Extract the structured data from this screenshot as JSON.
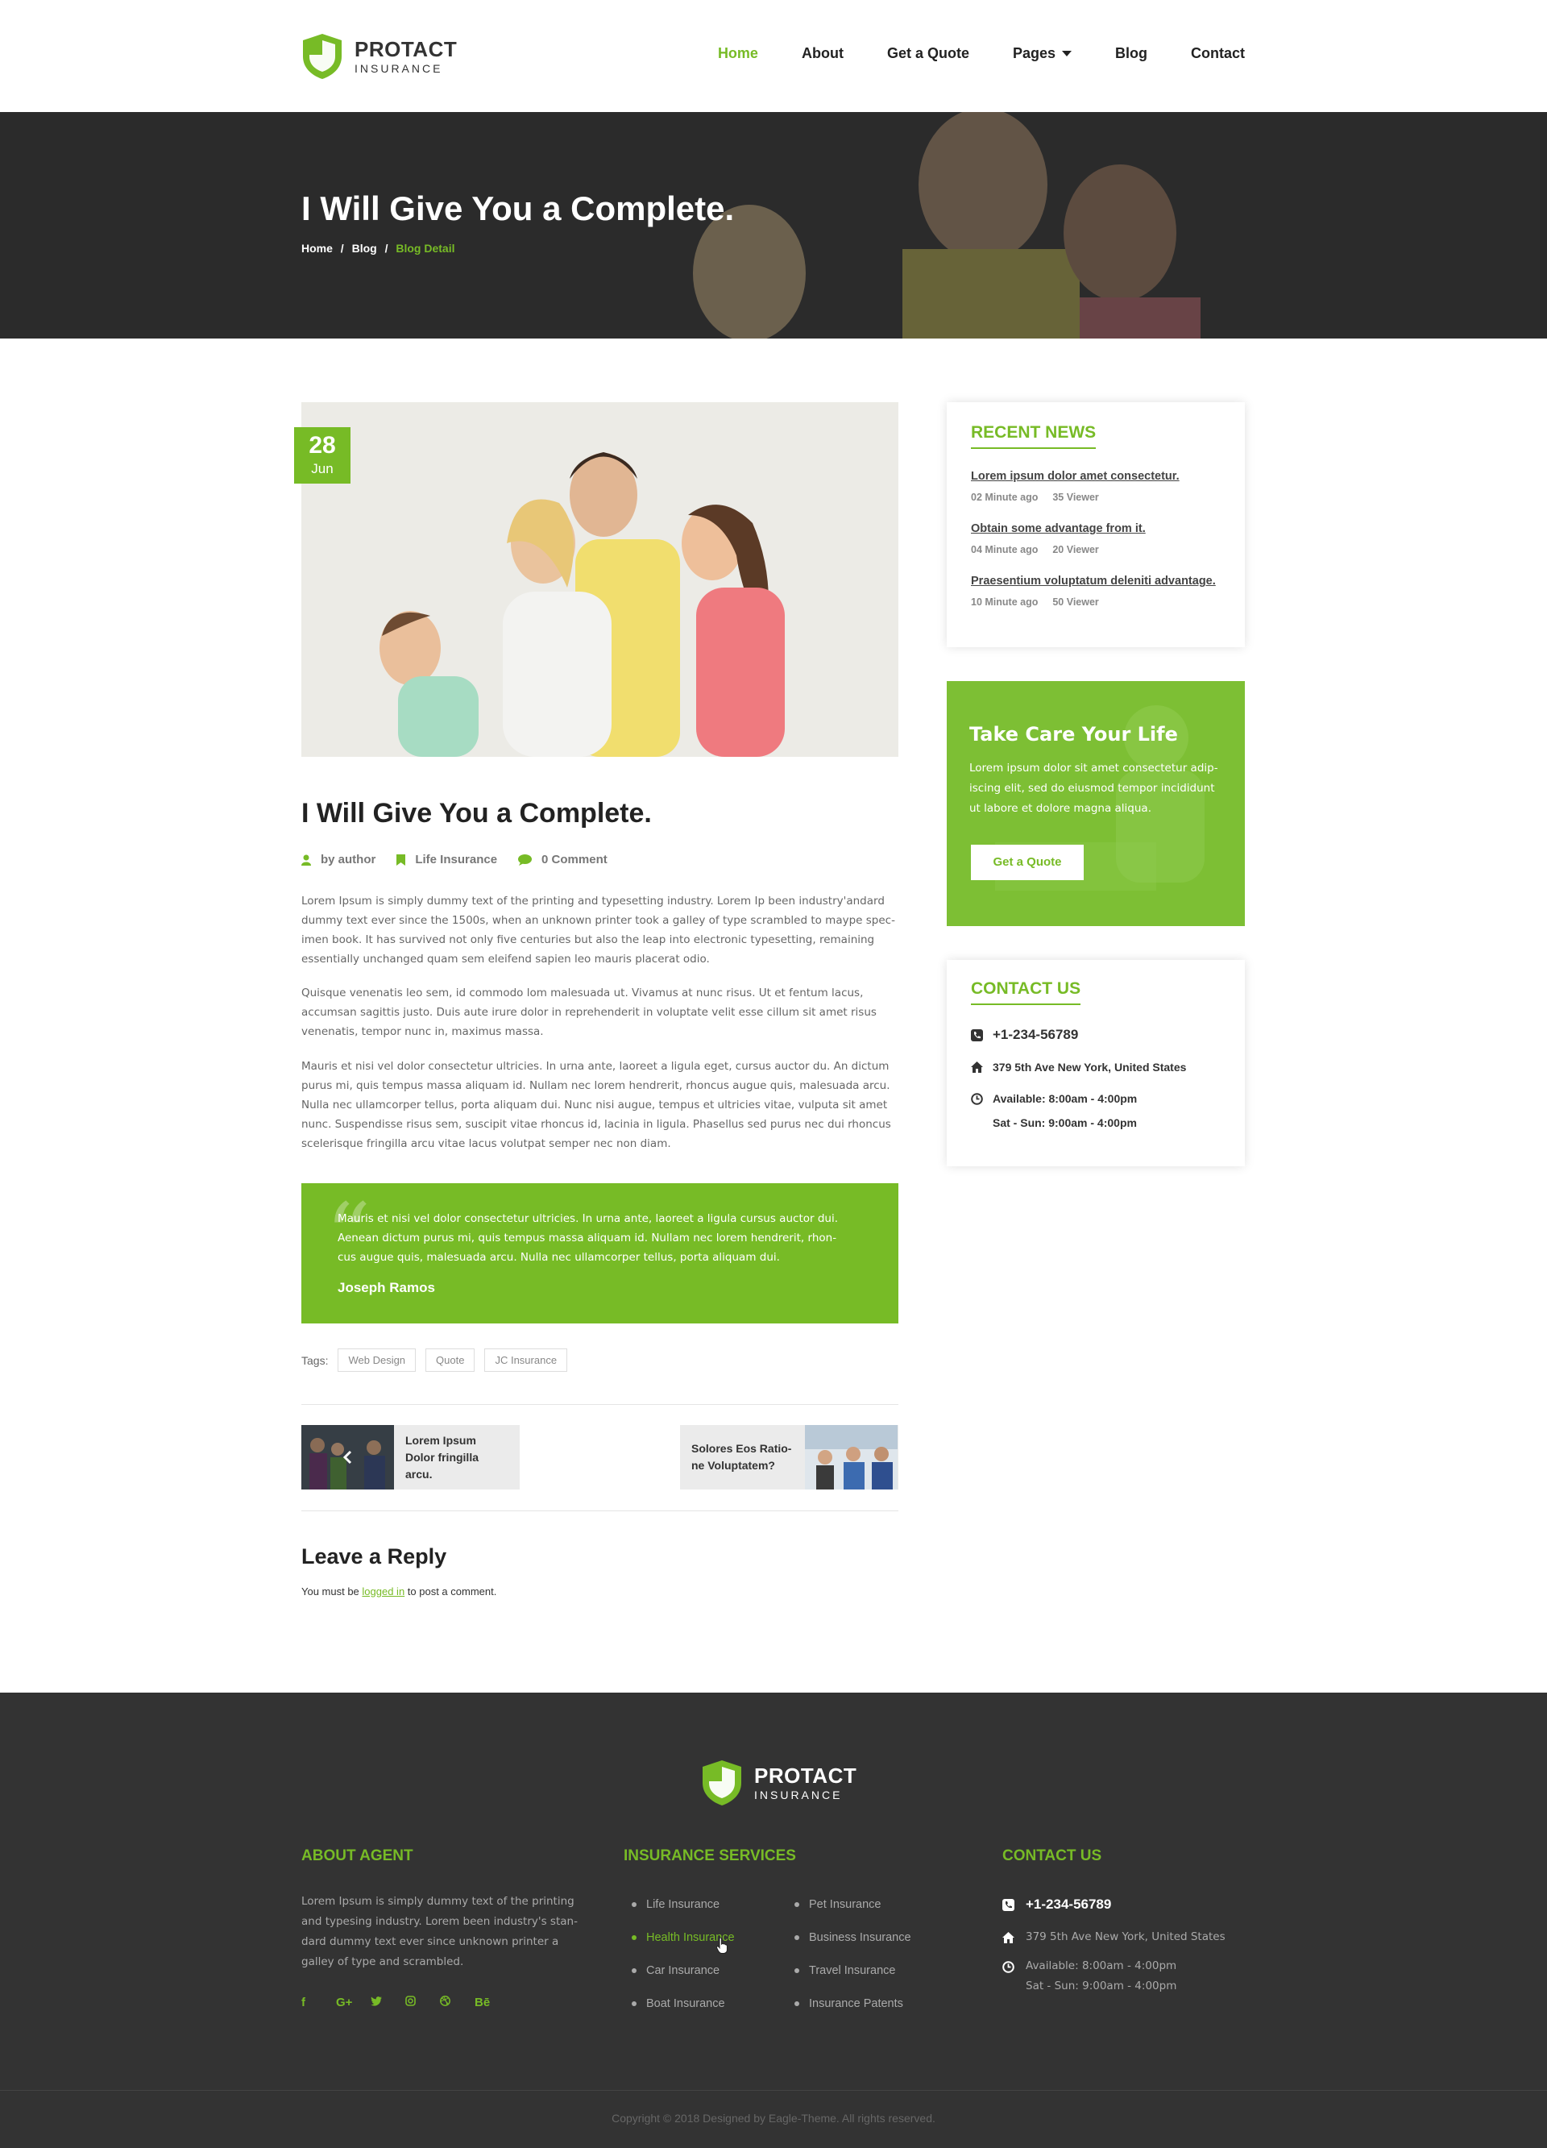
{
  "brand": {
    "name": "PROTACT",
    "tagline": "INSURANCE"
  },
  "colors": {
    "accent": "#77bb26",
    "dark": "#333333",
    "hero": "#2b2b2b"
  },
  "nav": {
    "items": [
      {
        "label": "Home",
        "active": true
      },
      {
        "label": "About"
      },
      {
        "label": "Get a Quote"
      },
      {
        "label": "Pages",
        "dropdown": true
      },
      {
        "label": "Blog"
      },
      {
        "label": "Contact"
      }
    ]
  },
  "hero": {
    "title": "I Will Give You a Complete.",
    "breadcrumb": [
      "Home",
      "/",
      "Blog",
      "/",
      "Blog Detail"
    ]
  },
  "post": {
    "date_day": "28",
    "date_month": "Jun",
    "title": "I Will Give You a Complete.",
    "meta": {
      "author": "by author",
      "category": "Life Insurance",
      "comments": "0 Comment"
    },
    "paragraphs": [
      "Lorem Ipsum is simply dummy text of the printing and typesetting industry. Lorem Ip been industry'andard dummy text ever since the 1500s, when an unknown printer took a galley of type scrambled to maype spec-imen book. It has survived not only five centuries but also the leap into electronic typesetting, remaining essentially unchanged quam sem eleifend sapien leo mauris placerat odio.",
      "Quisque venenatis leo sem, id commodo lom malesuada ut. Vivamus at nunc risus. Ut et fentum lacus, accumsan sagittis justo. Duis aute irure dolor in reprehenderit in voluptate velit esse cillum sit amet risus venenatis, tempor nunc in, maximus massa.",
      "Mauris et nisi vel dolor consectetur ultricies. In urna ante, laoreet a ligula eget, cursus auctor du. An dictum purus mi, quis tempus massa aliquam id. Nullam nec lorem hendrerit, rhoncus augue quis, malesuada arcu. Nulla nec ullamcorper tellus, porta aliquam dui. Nunc nisi augue, tempus et ultricies vitae, vulputa sit amet nunc. Suspendisse risus sem, suscipit vitae rhoncus id, lacinia in ligula. Phasellus sed purus nec dui rhoncus scelerisque fringilla arcu vitae lacus volutpat semper nec non diam."
    ],
    "quote": {
      "text": "Mauris et nisi vel dolor consectetur ultricies. In urna ante, laoreet a ligula  cursus auctor dui. Aenean dictum purus mi, quis tempus massa aliquam id. Nullam nec lorem hendrerit, rhon-cus augue quis, malesuada arcu. Nulla nec ullamcorper tellus, porta aliquam dui.",
      "author": "Joseph Ramos"
    },
    "tags_label": "Tags:",
    "tags": [
      "Web Design",
      "Quote",
      "JC Insurance"
    ],
    "prev_post": "Lorem Ipsum Dolor fringilla arcu.",
    "next_post": "Solores Eos Ratio-ne Voluptatem?"
  },
  "reply": {
    "heading": "Leave a Reply",
    "pre": "You must be ",
    "link": "logged in",
    "post": " to post a comment."
  },
  "sidebar": {
    "recent_title": "RECENT NEWS",
    "news": [
      {
        "title": "Lorem ipsum dolor amet consectetur.",
        "time": "02 Minute ago",
        "views": "35 Viewer"
      },
      {
        "title": "Obtain some advantage from it.",
        "time": "04 Minute ago",
        "views": "20 Viewer"
      },
      {
        "title": "Praesentium voluptatum deleniti advantage.",
        "time": "10 Minute ago",
        "views": "50 Viewer"
      }
    ],
    "promo": {
      "title": "Take Care Your Life",
      "text": "Lorem ipsum dolor sit amet consectetur adip-iscing elit, sed do eiusmod tempor incididunt ut labore et dolore magna aliqua.",
      "button": "Get a Quote"
    },
    "contact_title": "CONTACT US",
    "phone": "+1-234-56789",
    "address": "379 5th Ave New York, United States",
    "hours1": "Available: 8:00am - 4:00pm",
    "hours2": "Sat - Sun: 9:00am - 4:00pm"
  },
  "footer": {
    "about_title": "ABOUT AGENT",
    "about_text": "Lorem Ipsum is simply dummy text of the printing and typesing industry. Lorem been industry's stan-dard dummy text ever since  unknown printer a galley of type and scrambled.",
    "social": [
      "f",
      "G+",
      "twitter-icon",
      "instagram-icon",
      "dribbble-icon",
      "Bē"
    ],
    "services_title": "INSURANCE SERVICES",
    "services_col1": [
      "Life Insurance",
      "Health Insurance",
      "Car Insurance",
      "Boat Insurance"
    ],
    "services_col2": [
      "Pet Insurance",
      "Business Insurance",
      "Travel Insurance",
      "Insurance Patents"
    ],
    "contact_title": "CONTACT US",
    "phone": "+1-234-56789",
    "address": "379 5th Ave New York, United States",
    "hours1": "Available: 8:00am - 4:00pm",
    "hours2": "Sat - Sun: 9:00am - 4:00pm",
    "copyright": "Copyright © 2018 Designed by Eagle-Theme. All rights reserved."
  }
}
